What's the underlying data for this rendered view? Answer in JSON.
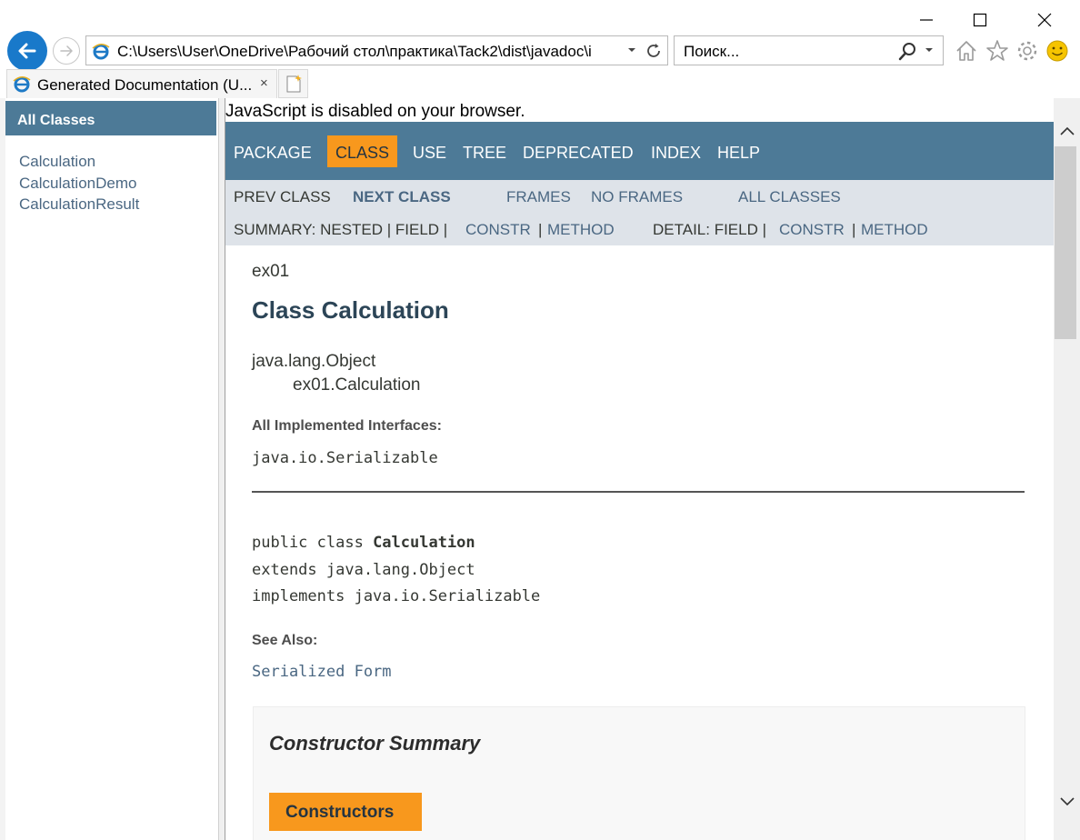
{
  "browser": {
    "address": "C:\\Users\\User\\OneDrive\\Рабочий стол\\практика\\Tack2\\dist\\javadoc\\i",
    "search_placeholder": "Поиск...",
    "tab_title": "Generated Documentation (U...",
    "tab_close": "×"
  },
  "left_frame": {
    "header": "All Classes",
    "classes": [
      "Calculation",
      "CalculationDemo",
      "CalculationResult"
    ]
  },
  "doc": {
    "js_disabled": "JavaScript is disabled on your browser.",
    "topnav": [
      "PACKAGE",
      "CLASS",
      "USE",
      "TREE",
      "DEPRECATED",
      "INDEX",
      "HELP"
    ],
    "subnav": {
      "prev_class": "PREV CLASS",
      "next_class": "NEXT CLASS",
      "frames": "FRAMES",
      "no_frames": "NO FRAMES",
      "all_classes": "ALL CLASSES",
      "summary_label": "SUMMARY: NESTED | FIELD |",
      "summary_constr": "CONSTR",
      "separator": "|",
      "summary_method": "METHOD",
      "detail_label": "DETAIL: FIELD |",
      "detail_constr": "CONSTR",
      "detail_method": "METHOD"
    },
    "package": "ex01",
    "class_title": "Class Calculation",
    "inheritance": [
      "java.lang.Object",
      "ex01.Calculation"
    ],
    "implemented_label": "All Implemented Interfaces:",
    "implemented_value": "java.io.Serializable",
    "declaration": {
      "line1_prefix": "public class ",
      "line1_name": "Calculation",
      "line2": "extends java.lang.Object",
      "line3": "implements java.io.Serializable"
    },
    "see_also_label": "See Also:",
    "see_also_link": "Serialized Form",
    "constructor_summary": "Constructor Summary",
    "constructors_tab": "Constructors"
  },
  "colors": {
    "nav_bg": "#4d7a97",
    "active_tab": "#f8981d",
    "subnav_bg": "#dee3e9",
    "link": "#4a6782",
    "back_button": "#1979ca"
  }
}
